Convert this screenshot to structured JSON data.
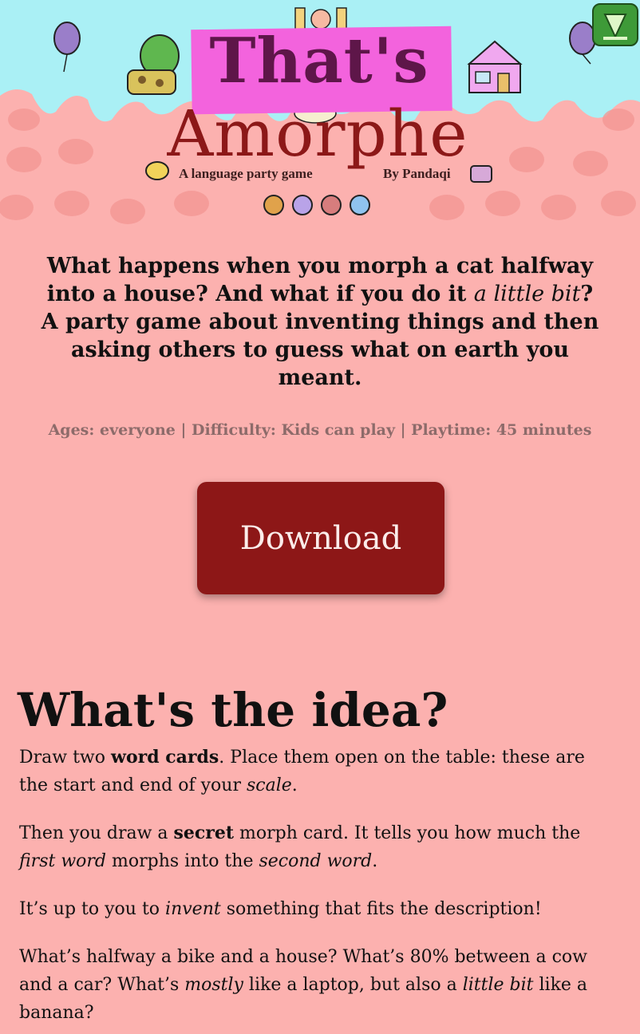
{
  "header": {
    "title_main": "That's",
    "title_sub": "Amorphe",
    "tagline": "A language party game",
    "byline": "By Pandaqi",
    "back_icon": "green-triangle-icon",
    "icons": [
      "microphone-icon",
      "torch-icon",
      "robot-icon",
      "cow-icon"
    ]
  },
  "intro": {
    "p1": "What happens when you morph a cat halfway into a house? And what if you do it ",
    "p2": "a little bit",
    "p3": "? A party game about inventing things and then asking others to guess what on earth you meant."
  },
  "meta": "Ages: everyone | Difficulty: Kids can play | Playtime: 45 minutes",
  "download_label": "Download",
  "idea": {
    "heading": "What's the idea?",
    "para1": {
      "a": "Draw two ",
      "b": "word cards",
      "c": ". Place them open on the table: these are the start and end of your ",
      "d": "scale",
      "e": "."
    },
    "para2": {
      "a": "Then you draw a ",
      "b": "secret",
      "c": " morph card. It tells you how much the ",
      "d": "first word",
      "e": " morphs into the ",
      "f": "second word",
      "g": "."
    },
    "para3": {
      "a": "It’s up to you to ",
      "b": "invent",
      "c": " something that fits the description!"
    },
    "para4": {
      "a": "What’s halfway a bike and a house? What’s 80% between a cow and a car? What’s ",
      "b": "mostly",
      "c": " like a laptop, but also a ",
      "d": "little bit",
      "e": " like a banana?"
    }
  },
  "colors": {
    "sky": "#aaf0f5",
    "salmon": "#fcb1af",
    "title_pink": "#f363dd",
    "title_dark": "#5e1649",
    "button": "#8d1717",
    "accent_red": "#8c1818"
  }
}
